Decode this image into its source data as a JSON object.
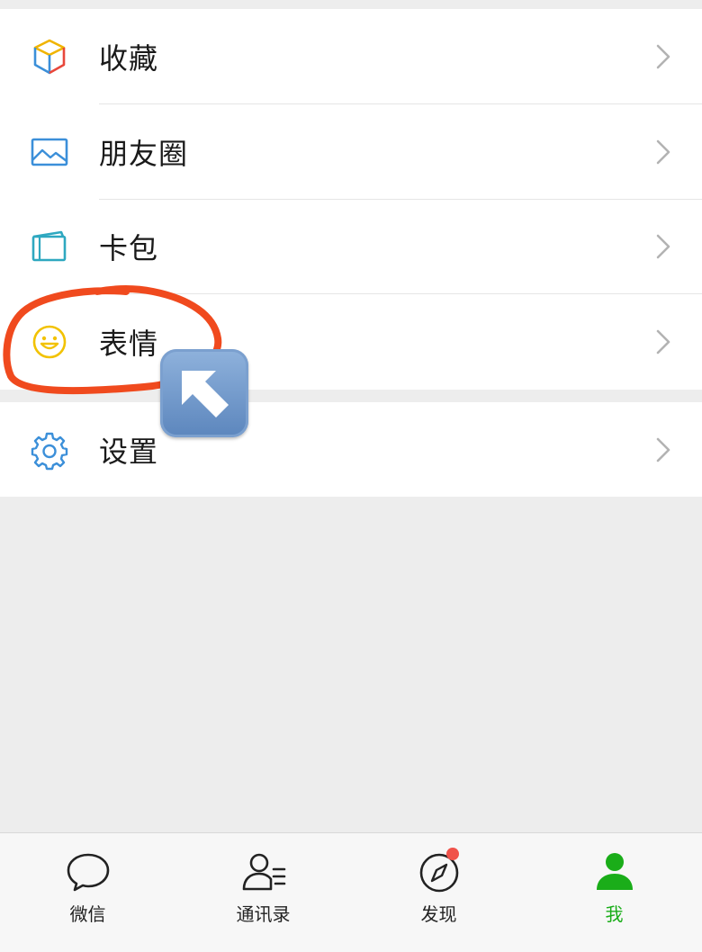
{
  "menu": {
    "items": [
      {
        "label": "收藏",
        "icon": "favorites-cube-icon"
      },
      {
        "label": "朋友圈",
        "icon": "moments-picture-icon"
      },
      {
        "label": "卡包",
        "icon": "card-wallet-icon"
      },
      {
        "label": "表情",
        "icon": "smiley-sticker-icon"
      },
      {
        "label": "设置",
        "icon": "settings-gear-icon"
      }
    ]
  },
  "annotation": {
    "circle_color": "#f04a1e",
    "arrow": "up-left-arrow-emoji"
  },
  "tabbar": {
    "tabs": [
      {
        "label": "微信",
        "icon": "chat-bubble-icon"
      },
      {
        "label": "通讯录",
        "icon": "contacts-icon"
      },
      {
        "label": "发现",
        "icon": "discover-compass-icon",
        "badge": "red-dot"
      },
      {
        "label": "我",
        "icon": "me-person-icon",
        "active": true
      }
    ],
    "active_color": "#1aad19"
  }
}
